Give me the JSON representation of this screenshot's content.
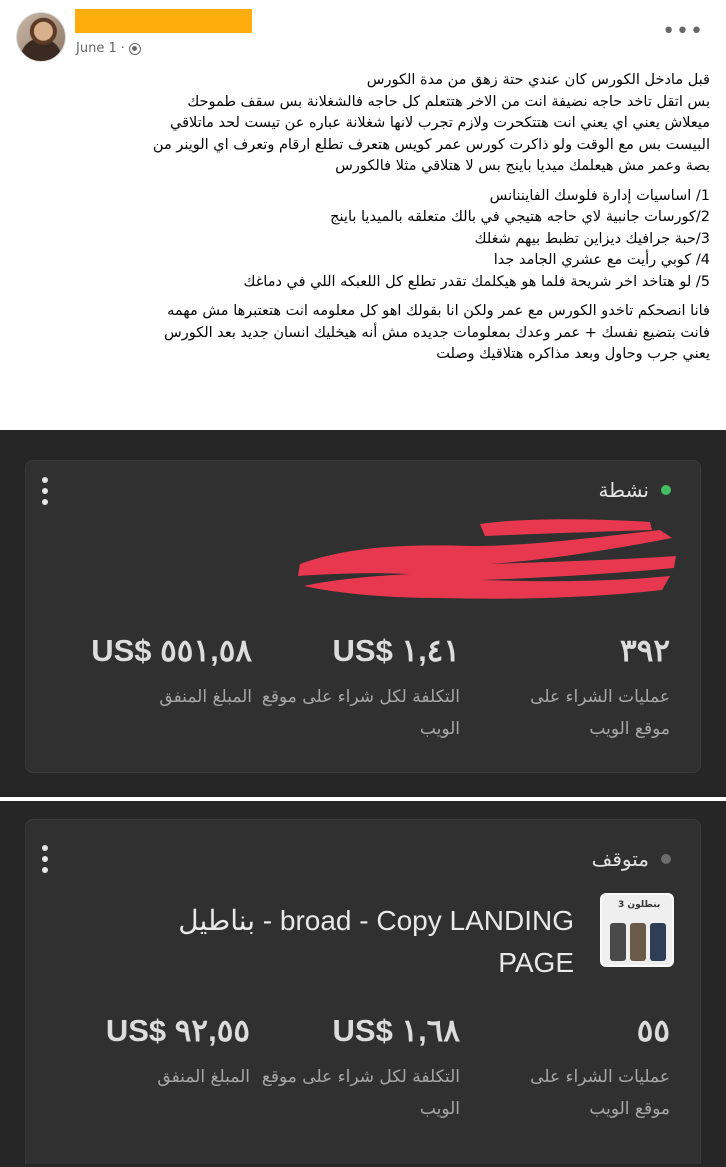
{
  "post": {
    "date": "June 1",
    "more_icon": "more-horizontal-icon",
    "privacy_icon": "globe-icon",
    "paragraphs": [
      [
        "قبل مادخل الكورس كان عندي حتة زهق من مدة الكورس",
        "بس اتقل تاخد حاجه نضيفة انت من الاخر هتتعلم كل حاجه فالشغلانة بس سقف طموحك",
        "ميعلاش يعني اي يعني انت هتتكحرت ولازم تجرب لانها شغلانة عباره عن تيست لحد ماتلاقي",
        "البيست بس مع الوقت ولو ذاكرت كورس عمر كويس هتعرف تطلع ارقام وتعرف اي الوينر من",
        "بصة وعمر مش هيعلمك ميديا باينج بس لا هتلاقي مثلا فالكورس"
      ],
      [
        "1/ اساسيات إدارة فلوسك الفايننانس",
        "2/كورسات جانبية لاي حاجه هتيجي في بالك متعلقه بالميديا باينج",
        "3/حبة جرافيك ديزاين تظبط بيهم شغلك",
        "4/ كوبي رأيت مع عشري الجامد جدا",
        "5/ لو هتاخد اخر شريحة فلما هو هيكلمك تقدر تطلع كل اللعبكه اللي في دماغك"
      ],
      [
        "فانا انصحكم تاخدو الكورس مع عمر ولكن انا بقولك اهو كل معلومه انت هتعتبرها مش مهمه",
        "فانت بتضيع نفسك + عمر وعدك بمعلومات جديده مش أنه هيخليك انسان جديد بعد الكورس",
        "يعني جرب وحاول وبعد مذاكره هتلاقيك وصلت"
      ]
    ]
  },
  "campaigns": [
    {
      "status_label": "نشطة",
      "status_color": "#45bd62",
      "menu_icon": "more-vertical-icon",
      "metrics": [
        {
          "value": "٣٩٢",
          "label": "عمليات الشراء على موقع الويب"
        },
        {
          "value": "US$ ١,٤١",
          "label": "التكلفة لكل شراء على موقع الويب"
        },
        {
          "value": "US$ ٥٥١,٥٨",
          "label": "المبلغ المنفق"
        }
      ]
    },
    {
      "status_label": "متوقف",
      "status_color": "#6b6b6b",
      "menu_icon": "more-vertical-icon",
      "ad_title": "بناطيل - broad - Copy LANDING PAGE",
      "thumbnail_text": "3 بنطلون",
      "metrics": [
        {
          "value": "٥٥",
          "label": "عمليات الشراء على موقع الويب"
        },
        {
          "value": "US$ ١,٦٨",
          "label": "التكلفة لكل شراء على موقع الويب"
        },
        {
          "value": "US$ ٩٢,٥٥",
          "label": "المبلغ المنفق"
        }
      ]
    }
  ]
}
